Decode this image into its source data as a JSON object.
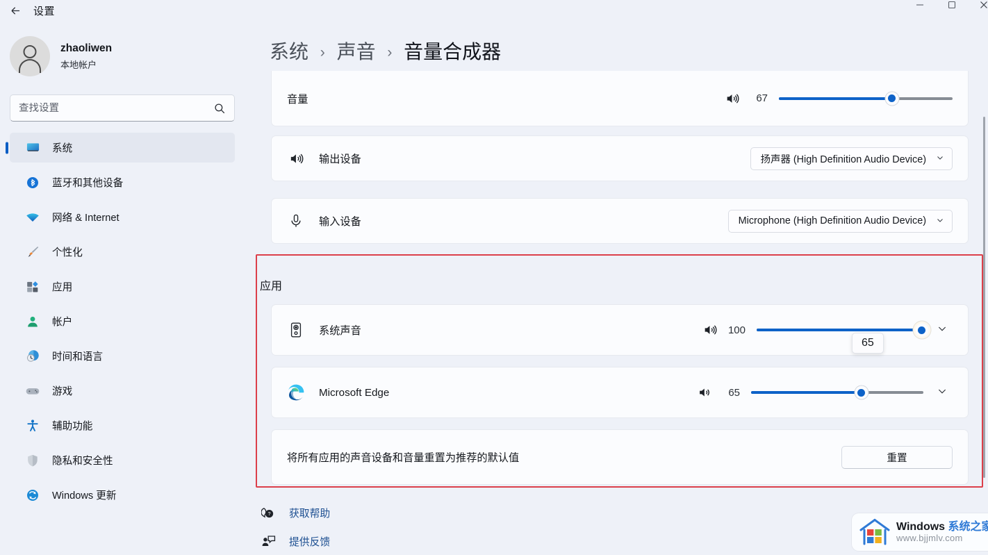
{
  "titlebar": {
    "back_label": "←",
    "title": "设置",
    "minimize": "—",
    "maximize": "▢",
    "close": "✕"
  },
  "sidebar": {
    "profile": {
      "name": "zhaoliwen",
      "subtitle": "本地帐户",
      "avatar_icon": "user-avatar-icon"
    },
    "search": {
      "placeholder": "查找设置",
      "value": "",
      "icon": "search-icon"
    },
    "items": [
      {
        "label": "系统",
        "icon": "monitor-icon",
        "active": true
      },
      {
        "label": "蓝牙和其他设备",
        "icon": "bluetooth-icon",
        "active": false
      },
      {
        "label": "网络 & Internet",
        "icon": "wifi-icon",
        "active": false
      },
      {
        "label": "个性化",
        "icon": "paintbrush-icon",
        "active": false
      },
      {
        "label": "应用",
        "icon": "apps-icon",
        "active": false
      },
      {
        "label": "帐户",
        "icon": "account-icon",
        "active": false
      },
      {
        "label": "时间和语言",
        "icon": "clock-globe-icon",
        "active": false
      },
      {
        "label": "游戏",
        "icon": "gamepad-icon",
        "active": false
      },
      {
        "label": "辅助功能",
        "icon": "accessibility-icon",
        "active": false
      },
      {
        "label": "隐私和安全性",
        "icon": "shield-icon",
        "active": false
      },
      {
        "label": "Windows 更新",
        "icon": "update-icon",
        "active": false
      }
    ]
  },
  "breadcrumb": {
    "level1": "系统",
    "sep1": "›",
    "level2": "声音",
    "sep2": "›",
    "current": "音量合成器"
  },
  "main": {
    "volume_row": {
      "label": "音量",
      "speaker_icon": "speaker-wave-icon",
      "value": "67",
      "percent": 65
    },
    "output_row": {
      "label": "输出设备",
      "icon": "speaker-wave-icon",
      "selected": "扬声器 (High Definition Audio Device)",
      "chevron": "chevron-down-icon"
    },
    "input_row": {
      "label": "输入设备",
      "icon": "microphone-icon",
      "selected": "Microphone (High Definition Audio Device)",
      "chevron": "chevron-down-icon"
    },
    "apps_section": {
      "title": "应用",
      "highlight_color": "#dc3f4a",
      "rows": [
        {
          "label": "系统声音",
          "icon": "system-speaker-icon",
          "speaker_icon": "speaker-wave-icon",
          "value": "100",
          "percent": 99,
          "expand": "chevron-down-icon"
        },
        {
          "label": "Microsoft Edge",
          "icon": "microsoft-edge-icon",
          "speaker_icon": "speaker-wave-icon",
          "value": "65",
          "percent": 64,
          "expand": "chevron-down-icon"
        }
      ],
      "tooltip_value": "65",
      "reset": {
        "description": "将所有应用的声音设备和音量重置为推荐的默认值",
        "button_label": "重置"
      }
    }
  },
  "footer": {
    "help": {
      "label": "获取帮助",
      "icon": "help-bubble-icon"
    },
    "feedback": {
      "label": "提供反馈",
      "icon": "feedback-icon"
    }
  },
  "watermark": {
    "line1_a": "Windows ",
    "line1_b": "系统之家",
    "line2": "www.bjjmlv.com"
  }
}
